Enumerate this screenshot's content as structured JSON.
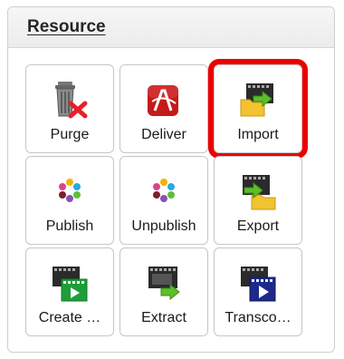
{
  "panel": {
    "title": "Resource"
  },
  "actions": [
    {
      "label": "Purge",
      "icon": "trash-delete-icon"
    },
    {
      "label": "Deliver",
      "icon": "deliver-icon"
    },
    {
      "label": "Import",
      "icon": "import-folder-icon",
      "selected": true
    },
    {
      "label": "Publish",
      "icon": "publish-dots-icon"
    },
    {
      "label": "Unpublish",
      "icon": "unpublish-dots-icon"
    },
    {
      "label": "Export",
      "icon": "export-folder-icon"
    },
    {
      "label": "Create …",
      "icon": "create-video-icon"
    },
    {
      "label": "Extract",
      "icon": "extract-video-icon"
    },
    {
      "label": "Transco…",
      "icon": "transcode-video-icon"
    }
  ],
  "colors": {
    "selection_outline": "#ec0000",
    "tile_border": "#c6c6c6"
  }
}
